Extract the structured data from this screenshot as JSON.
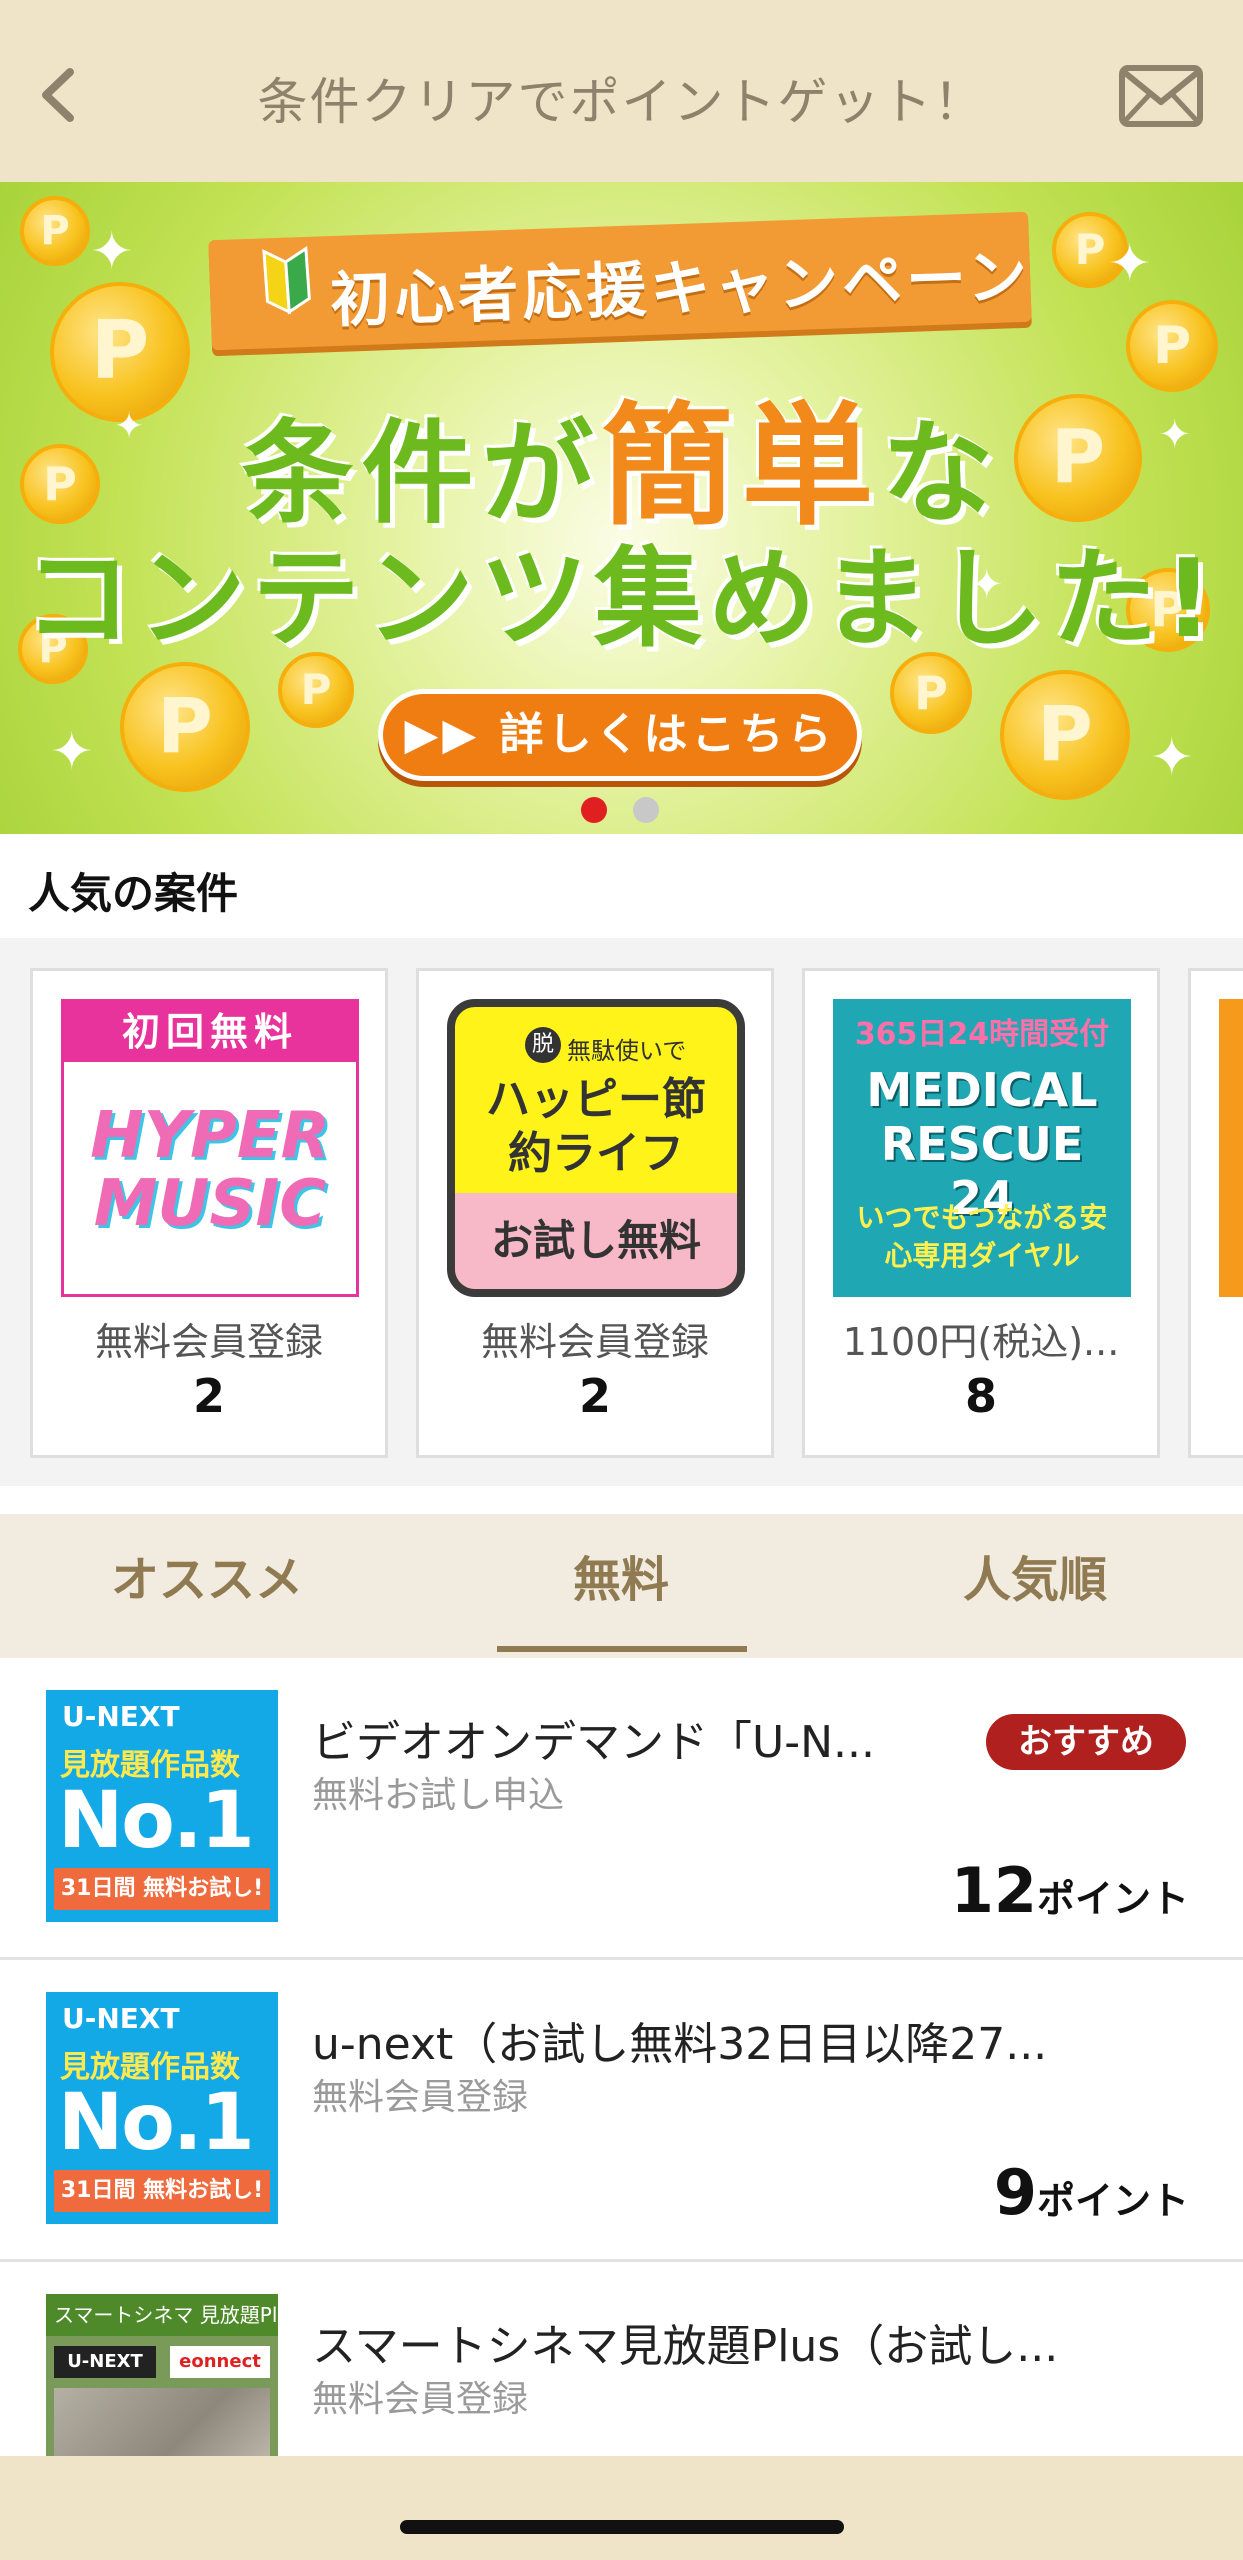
{
  "header": {
    "title": "条件クリアでポイントゲット！",
    "back_icon": "chevron-left-icon",
    "mail_icon": "mail-icon"
  },
  "banner": {
    "ribbon": "初心者応援キャンペーン",
    "line1_pre": "条件が",
    "line1_accent": "簡単",
    "line1_post": "な",
    "line2": "コンテンツ集めました!",
    "cta": "▶▶ 詳しくはこちら",
    "coin_letter": "P",
    "carousel": {
      "count": 2,
      "active": 1
    }
  },
  "popular": {
    "title": "人気の案件",
    "cards": [
      {
        "label": "無料会員登録",
        "points": "2",
        "thumb_top": "初回無料",
        "thumb_main": "HYPER MUSIC"
      },
      {
        "label": "無料会員登録",
        "points": "2",
        "thumb_small": "無駄使いで",
        "thumb_main": "ハッピー節約ライフ",
        "thumb_bottom": "お試し無料",
        "thumb_badge": "脱"
      },
      {
        "label": "1100円(税込)...",
        "points": "8",
        "thumb_top": "365日24時間受付",
        "thumb_main": "MEDICAL RESCUE 24",
        "thumb_bottom": "いつでもつながる安心専用ダイヤル"
      }
    ]
  },
  "tabs": [
    {
      "label": "オススメ",
      "active": false
    },
    {
      "label": "無料",
      "active": true
    },
    {
      "label": "人気順",
      "active": false
    }
  ],
  "list": [
    {
      "title": "ビデオオンデマンド「U-N...",
      "subtitle": "無料お試し申込",
      "points": "12",
      "unit": "ポイント",
      "badge": "おすすめ",
      "thumb": {
        "brand": "U-NEXT",
        "mid": "見放題作品数",
        "main": "No.1",
        "foot": "31日間 無料お試し!"
      }
    },
    {
      "title": "u-next（お試し無料32日目以降27...",
      "subtitle": "無料会員登録",
      "points": "9",
      "unit": "ポイント",
      "thumb": {
        "brand": "U-NEXT",
        "mid": "見放題作品数",
        "main": "No.1",
        "foot": "31日間 無料お試し!"
      }
    },
    {
      "title": "スマートシネマ見放題Plus（お試し...",
      "subtitle": "無料会員登録",
      "thumb": {
        "top": "スマートシネマ 見放題Plus",
        "brand": "U-NEXT",
        "partner": "eonnect"
      }
    }
  ],
  "colors": {
    "header_bg": "#efe3c8",
    "tab_text": "#8f7a52",
    "badge_bg": "#b0201f",
    "banner_green": "#6dba1e",
    "banner_orange": "#f28a1b",
    "carousel_active": "#e02020",
    "carousel_inactive": "#c8c8c8"
  }
}
